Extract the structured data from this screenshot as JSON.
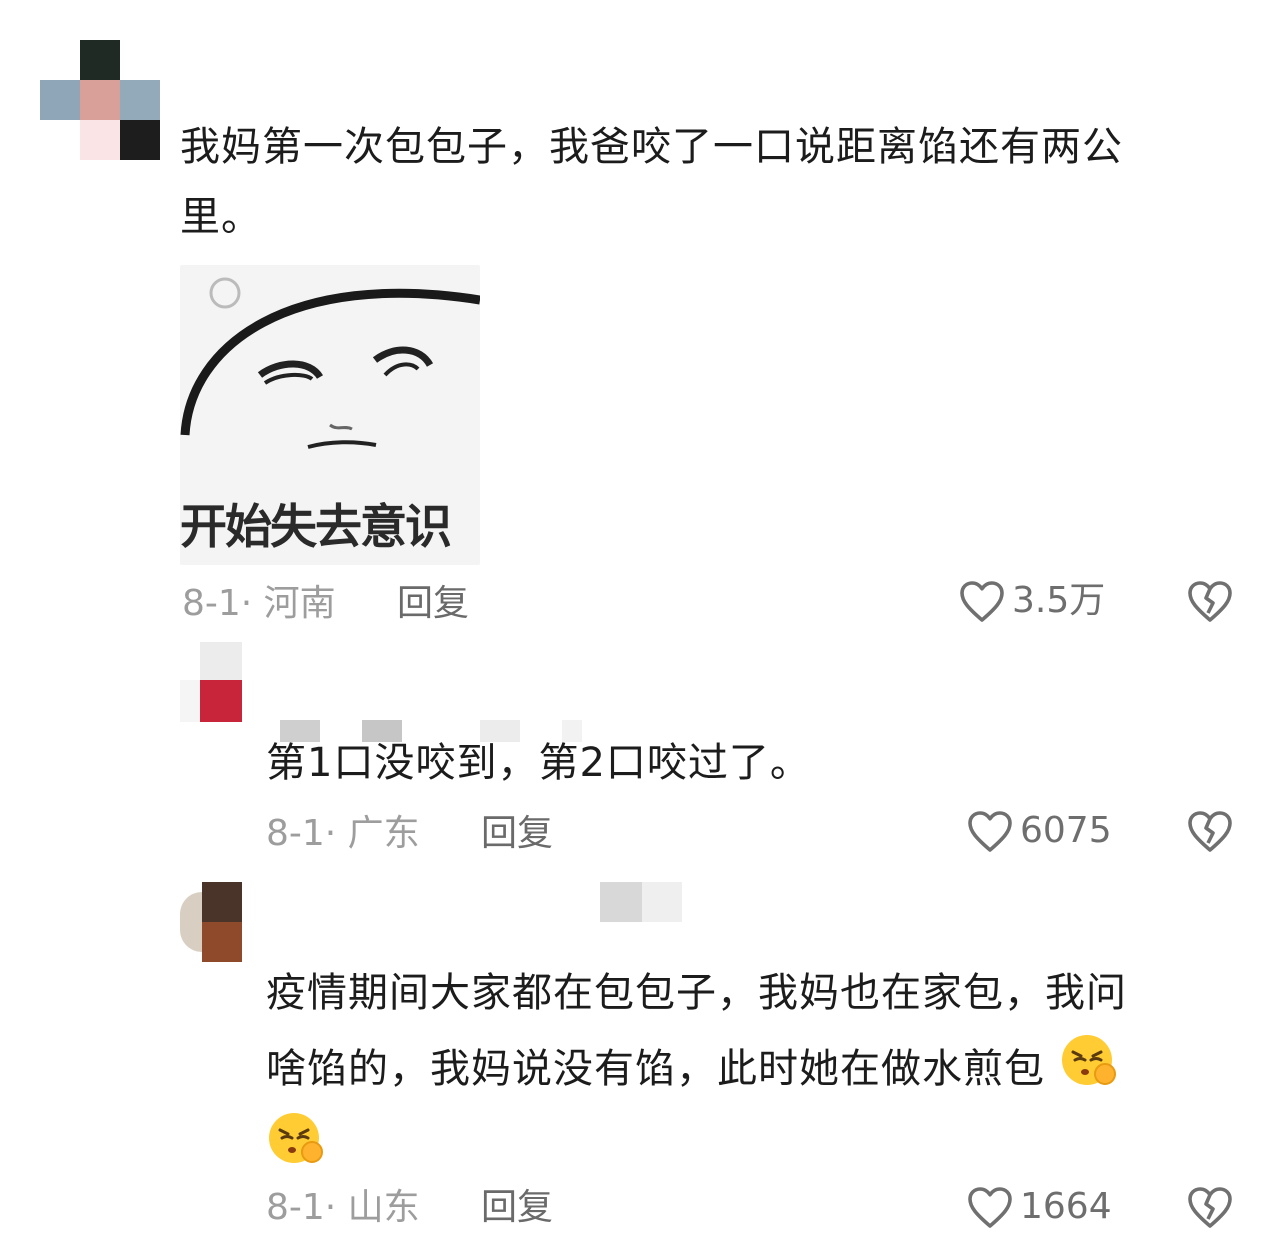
{
  "comments": [
    {
      "text_line1": "我妈第一次包包子，我爸咬了一口说距离馅还有两公",
      "text_line2": "里。",
      "sticker_caption": "开始失去意识",
      "date_location": "8-1· 河南",
      "reply_label": "回复",
      "like_count": "3.5万"
    },
    {
      "text_line1": "第1口没咬到，第2口咬过了。",
      "date_location": "8-1· 广东",
      "reply_label": "回复",
      "like_count": "6075"
    },
    {
      "text_line1": "疫情期间大家都在包包子，我妈也在家包，我问",
      "text_line2": "啥馅的，我妈说没有馅，此时她在做水煎包",
      "date_location": "8-1· 山东",
      "reply_label": "回复",
      "like_count": "1664"
    }
  ],
  "colors": {
    "meta_text": "#9d9d9d",
    "reply_text": "#6a6a6a",
    "icon_stroke": "#707070",
    "emoji_yellow": "#ffcc33"
  },
  "icons": [
    "heart-outline-icon",
    "broken-heart-icon",
    "shushing-emoji-icon"
  ]
}
